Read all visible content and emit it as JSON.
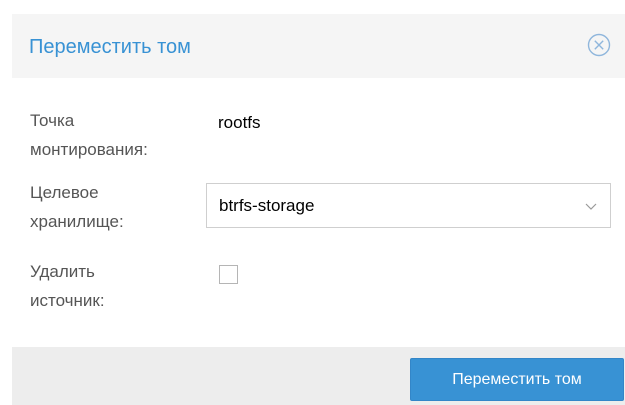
{
  "dialog": {
    "title": "Переместить том",
    "close_icon": "circle-x-icon"
  },
  "form": {
    "mount_point": {
      "label_line1": "Точка",
      "label_line2": "монтирования:",
      "value": "rootfs"
    },
    "target_storage": {
      "label_line1": "Целевое",
      "label_line2": "хранилище:",
      "selected": "btrfs-storage",
      "arrow_icon": "chevron-down-icon"
    },
    "delete_source": {
      "label_line1": "Удалить",
      "label_line2": "источник:",
      "checked": false
    }
  },
  "footer": {
    "submit_label": "Переместить том"
  },
  "colors": {
    "accent": "#3892d4",
    "header_bg": "#f5f5f5",
    "footer_bg": "#ededed"
  }
}
